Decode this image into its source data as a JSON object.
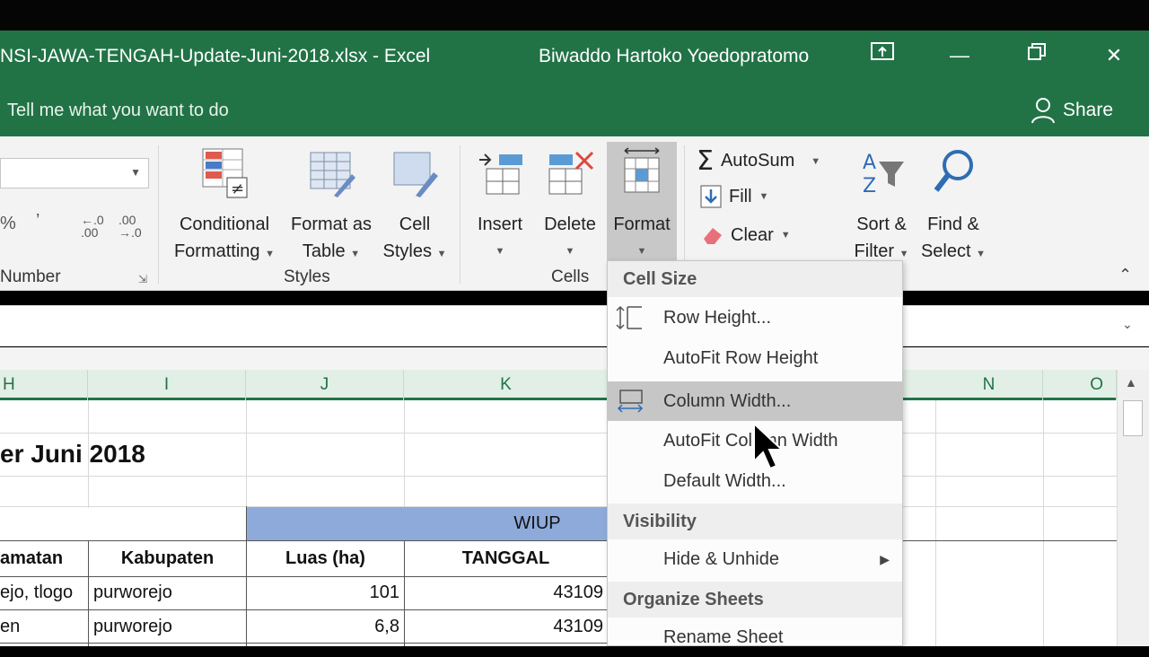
{
  "window": {
    "title": "NSI-JAWA-TENGAH-Update-Juni-2018.xlsx  -  Excel",
    "user": "Biwaddo Hartoko Yoedopratomo"
  },
  "tell": {
    "placeholder": "Tell me what you want to do",
    "share_label": "Share"
  },
  "ribbon": {
    "number_group": {
      "label": "Number",
      "percent": "%",
      "comma": "ʼ",
      "inc_decimal": "←.0\n.00",
      "dec_decimal": ".00\n→.0"
    },
    "styles_group": {
      "label": "Styles",
      "conditional_formatting": [
        "Conditional",
        "Formatting"
      ],
      "format_as_table": [
        "Format as",
        "Table"
      ],
      "cell_styles": [
        "Cell",
        "Styles"
      ]
    },
    "cells_group": {
      "label": "Cells",
      "insert": "Insert",
      "delete": "Delete",
      "format": "Format"
    },
    "editing_group": {
      "autosum": "AutoSum",
      "fill": "Fill",
      "clear": "Clear",
      "sort_filter": [
        "Sort &",
        "Filter"
      ],
      "find_select": [
        "Find &",
        "Select"
      ]
    }
  },
  "columns": [
    "H",
    "I",
    "J",
    "K",
    "N",
    "O"
  ],
  "cells": {
    "title": "er Juni 2018",
    "wiup": "WIUP",
    "header_kecamatan": "amatan",
    "header_kabupaten": "Kabupaten",
    "header_luas": "Luas (ha)",
    "header_tanggal": "TANGGAL",
    "rows": [
      {
        "kecamatan": "ejo, tlogo",
        "kabupaten": "purworejo",
        "luas": "101",
        "tanggal": "43109"
      },
      {
        "kecamatan": "en",
        "kabupaten": "purworejo",
        "luas": "6,8",
        "tanggal": "43109"
      }
    ]
  },
  "format_menu": {
    "cell_size": "Cell Size",
    "row_height": "Row Height...",
    "autofit_row_height": "AutoFit Row Height",
    "column_width": "Column Width...",
    "autofit_column_width": "AutoFit Column Width",
    "default_width": "Default Width...",
    "visibility": "Visibility",
    "hide_unhide": "Hide & Unhide",
    "organize_sheets": "Organize Sheets",
    "rename_sheet": "Rename Sheet"
  },
  "colors": {
    "excel_green": "#217346",
    "wiup_header": "#8eaadb",
    "menu_highlight": "#c6c6c6"
  }
}
